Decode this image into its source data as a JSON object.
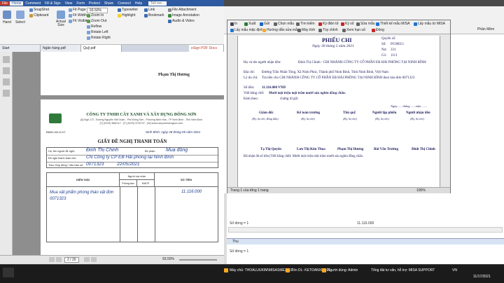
{
  "pdf": {
    "tabs": [
      "File",
      "Home",
      "Comment",
      "Fill & Sign",
      "View",
      "Form",
      "Protect",
      "Share",
      "Connect",
      "Help"
    ],
    "tell_me": "Tell me...",
    "ribbon": {
      "hand": "Hand",
      "select": "Select",
      "snapshot": "SnapShot",
      "clipboard": "Clipboard",
      "actual_size": "Actual Size",
      "fit_page": "Fit Page",
      "fit_width": "Fit Width",
      "fit_visible": "Fit Visible",
      "zoom": "93.50%",
      "zoom_in": "Zoom In",
      "zoom_out": "Zoom Out",
      "reflow": "Reflow",
      "rotate_left": "Rotate Left",
      "rotate_right": "Rotate Right",
      "typewriter": "Typewriter",
      "highlight": "Highlight",
      "link": "Link",
      "bookmark": "Bookmark",
      "file_attachment": "File Attachment",
      "image_annotation": "Image Annotation",
      "audio_video": "Audio & Video"
    },
    "doc_tabs": [
      "Start",
      "Ngân hàng.pdf",
      "Quỹ.pdf"
    ],
    "sign_label": "eSign PDF Docs",
    "page1": {
      "signer": "Phạm Thị Hương"
    },
    "page2": {
      "company": "CÔNG TY TNHH CÂY XANH VÀ XÂY DỰNG ĐÔNG SƠN",
      "address": "[A] Ngõ 172 - Đường Nguyễn Việt Xuân - Phố Đông Sơn - Phường Ninh Hòa - TP Ninh Bình - Tỉnh Ninh Bình",
      "phone": "[T] (0229) 3882117 - (F) (0229) 3720737 - [W] www.caryxanhdongson.com",
      "doc_code": "BM02-NV-D.KT",
      "date": "Ninh Bình, ngày 28 tháng 05 năm 2021",
      "title": "GIẤY ĐỀ NGHỊ THANH TOÁN",
      "row1_label": "Họ, tên người đề nghị:",
      "row1_value": "Đinh Thị Chinh",
      "dept_label": "Bộ phận :",
      "dept_value": "Mua đồng",
      "row2_label": "Đề nghị thanh toán cho:",
      "row2_value": "CN Công ty CP EB Hải phòng tại Ninh Bình",
      "row3_label": "Theo Hợp đồng / Văn bản số:",
      "row3_value": "0071323",
      "row3_date": "22/05/2021",
      "col_desc": "DIỄN GIẢI",
      "col_approver": "Người xác nhận",
      "col_dept": "Phòng ban",
      "col_account": "KMCP",
      "col_amount": "SỐ TIỀN",
      "item_desc": "Mua vật phẩm phòng tháo vật đơn 0071323",
      "item_amount": "11.116.000"
    },
    "status": {
      "page": "2 / 20",
      "zoom": "93.50%"
    }
  },
  "excel": {
    "title_right": "Phần Mềm",
    "toolbar": [
      "In",
      "Xuất",
      "Gửi",
      "Chọn mẫu",
      "Tìm kiếm",
      "Ký điện tử",
      "Ký số",
      "Sửa mẫu",
      "Thiết kế mẫu MISA",
      "Lấy mẫu từ MISA",
      "Lấy mẫu mặc định",
      "Hướng dẫn sửa mẫu",
      "Máy tính",
      "Tùy chỉnh",
      "Xem hạn sử",
      "Đóng"
    ],
    "voucher": {
      "title": "PHIẾU CHI",
      "date": "Ngày 30 tháng 5 năm 2021",
      "book_label": "Quyển số:",
      "book_value": "",
      "no_label": "Số:",
      "no_value": "PC00013",
      "debit_label": "Nợ:",
      "debit_value": "331",
      "credit_label": "Có:",
      "credit_value": "1111",
      "payee_label": "Họ và tên người nhận tiền:",
      "payee_value": "Đinh Thị Chinh - CHI NHÁNH CÔNG TY CỔ PHẦN EB HẢI PHÒNG TẠI NINH BÌNH",
      "addr_label": "Địa chỉ:",
      "addr_value": "Đường Trần Nhân Tông, Xã Ninh Phúc, Thành phố Ninh Bình, Tỉnh Ninh Bình, Việt Nam",
      "reason_label": "Lý do chi:",
      "reason_value": "Trả tiền cho CHI NHÁNH CÔNG TY CỔ PHẦN EB HẢI PHÒNG TẠI NINH BÌNH theo hóa đơn 0071323",
      "amount_label": "Số tiền:",
      "amount_value": "11.116.000 VND",
      "words_label": "Viết bằng chữ:",
      "words_value": "Mười một triệu một trăm mười sáu nghìn đồng chẵn.",
      "attach_label": "Kèm theo:",
      "attach_value": "chứng từ gốc",
      "sign_date": "Ngày ..... tháng ..... năm .......",
      "roles": [
        "Giám đốc",
        "Kế toán trưởng",
        "Thủ quỹ",
        "Người lập phiếu",
        "Người nhận tiền"
      ],
      "role_notes": [
        "(Ký, họ tên, đóng dấu)",
        "(Ký, họ tên)",
        "(Ký, họ tên)",
        "(Ký, họ tên)",
        "(Ký, họ tên)"
      ],
      "names": [
        "Tạ Thị Quyên",
        "Lưu Thị Kim Thoa",
        "Phạm Thị Hương",
        "Bùi Văn Trường",
        "Đinh Thị Chinh"
      ],
      "received": "Đã nhận đủ số tiền (Viết bằng chữ):  Mười một triệu một trăm mười sáu nghìn đồng chẵn."
    },
    "viewer_status": "Trang 1 của tổng 1 trang",
    "viewer_zoom": "100%",
    "sheet_rows": "Số dòng = 1",
    "sheet_total": "11.116.000",
    "sheet_rows2": "Số dòng = 1",
    "panel_title": "Thu"
  },
  "taskbar": {
    "items": [
      "Máy chủ: THOALUUKIM\\MISASME2019",
      "Tên DL: KETOANXNO21",
      "Người dùng: Admin",
      "Tổng đài tư vấn, hỗ trợ: MISA SUPPORT"
    ],
    "lang": "VN",
    "time": "11/17/2021"
  }
}
